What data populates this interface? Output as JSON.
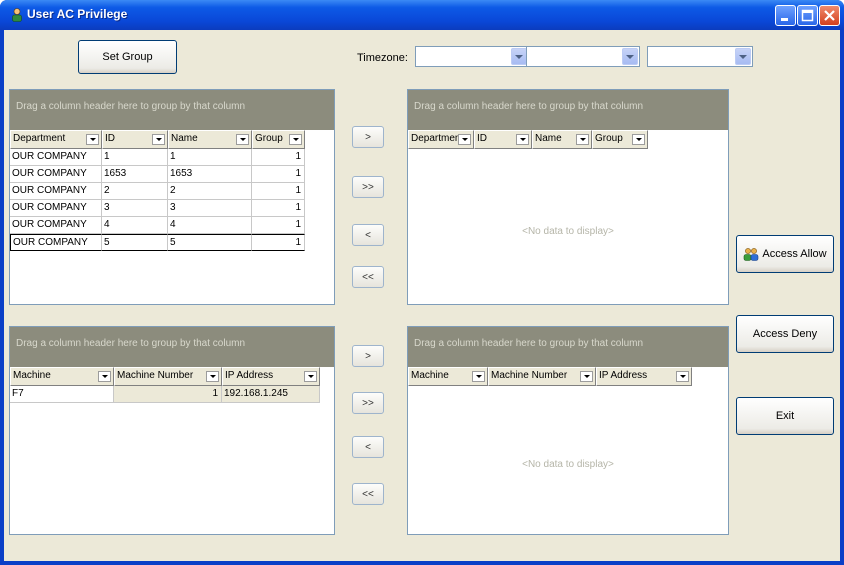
{
  "window": {
    "title": "User AC Privilege"
  },
  "toolbar": {
    "set_group_label": "Set Group",
    "timezone_label": "Timezone:",
    "timezone_values": [
      "",
      "",
      ""
    ]
  },
  "grids": {
    "users_left": {
      "group_hint": "Drag a column header here to group by that column",
      "columns": [
        "Department",
        "ID",
        "Name",
        "Group"
      ],
      "rows": [
        [
          "OUR COMPANY",
          "1",
          "1",
          "1"
        ],
        [
          "OUR COMPANY",
          "1653",
          "1653",
          "1"
        ],
        [
          "OUR COMPANY",
          "2",
          "2",
          "1"
        ],
        [
          "OUR COMPANY",
          "3",
          "3",
          "1"
        ],
        [
          "OUR COMPANY",
          "4",
          "4",
          "1"
        ],
        [
          "OUR COMPANY",
          "5",
          "5",
          "1"
        ]
      ]
    },
    "users_right": {
      "group_hint": "Drag a column header here to group by that column",
      "columns": [
        "Department",
        "ID",
        "Name",
        "Group"
      ],
      "empty_text": "<No data to display>"
    },
    "machines_left": {
      "group_hint": "Drag a column header here to group by that column",
      "columns": [
        "Machine",
        "Machine Number",
        "IP Address"
      ],
      "rows": [
        [
          "F7",
          "1",
          "192.168.1.245"
        ]
      ]
    },
    "machines_right": {
      "group_hint": "Drag a column header here to group by that column",
      "columns": [
        "Machine",
        "Machine Number",
        "IP Address"
      ],
      "empty_text": "<No data to display>"
    }
  },
  "move_buttons": {
    "add_one": ">",
    "add_all": ">>",
    "remove_one": "<",
    "remove_all": "<<"
  },
  "actions": {
    "access_allow": "Access Allow",
    "access_deny": "Access Deny",
    "exit": "Exit"
  }
}
